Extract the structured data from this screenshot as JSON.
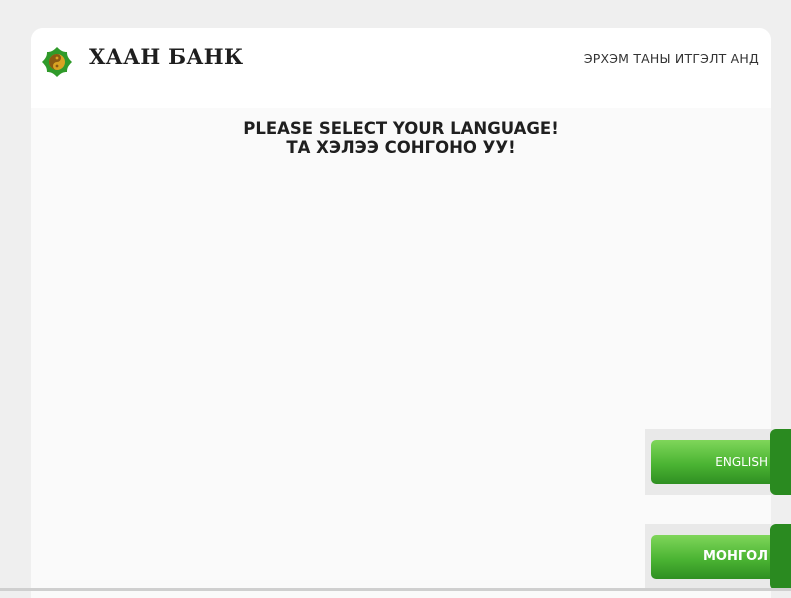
{
  "header": {
    "logo_icon": "khan-bank-logo-icon",
    "brand_name": "ХААН БАНК",
    "slogan": "ЭРХЭМ ТАНЫ ИТГЭЛТ АНД"
  },
  "main": {
    "title_en": "PLEASE SELECT YOUR LANGUAGE!",
    "title_mn": "ТА ХЭЛЭЭ СОНГОНО УУ!"
  },
  "buttons": {
    "english": "ENGLISH",
    "mongolian": "МОНГОЛ"
  },
  "colors": {
    "button_green": "#4bb433",
    "logo_green": "#2f9a2a",
    "logo_gold": "#d9a323"
  }
}
